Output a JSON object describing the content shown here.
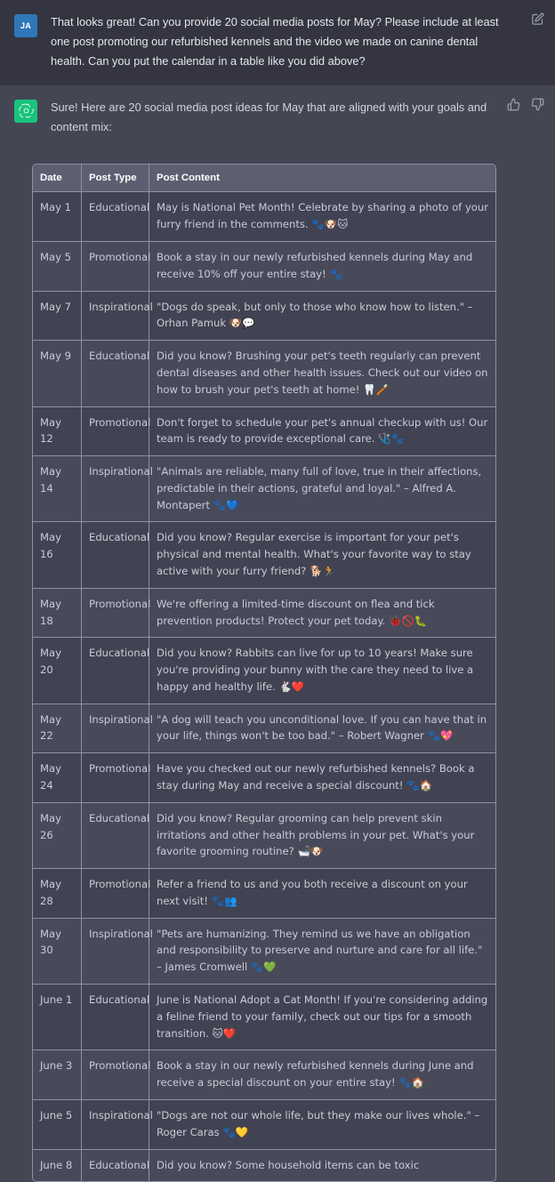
{
  "conversation": {
    "user_message": {
      "avatar_initials": "JA",
      "avatar_color": "#2f77b8",
      "text": "That looks great! Can you provide 20 social media posts for May? Please include at least one post promoting our refurbished kennels and the video we made on canine dental health. Can you put the calendar in a table like you did above?",
      "edit_icon": "edit-pencil-square-icon"
    },
    "assistant_message": {
      "avatar_color": "#19c37d",
      "avatar_icon": "openai-logo-icon",
      "text": "Sure! Here are 20 social media post ideas for May that are aligned with your goals and content mix:",
      "thumbs_up_icon": "thumbs-up-icon",
      "thumbs_down_icon": "thumbs-down-icon"
    }
  },
  "table": {
    "headers": [
      "Date",
      "Post Type",
      "Post Content"
    ],
    "rows": [
      {
        "date": "May 1",
        "type": "Educational",
        "content": "May is National Pet Month! Celebrate by sharing a photo of your furry friend in the comments. 🐾🐶🐱"
      },
      {
        "date": "May 5",
        "type": "Promotional",
        "content": "Book a stay in our newly refurbished kennels during May and receive 10% off your entire stay! 🐾"
      },
      {
        "date": "May 7",
        "type": "Inspirational",
        "content": "\"Dogs do speak, but only to those who know how to listen.\" – Orhan Pamuk 🐶💬"
      },
      {
        "date": "May 9",
        "type": "Educational",
        "content": "Did you know? Brushing your pet's teeth regularly can prevent dental diseases and other health issues. Check out our video on how to brush your pet's teeth at home! 🦷🪥"
      },
      {
        "date": "May 12",
        "type": "Promotional",
        "content": "Don't forget to schedule your pet's annual checkup with us! Our team is ready to provide exceptional care. 🩺🐾"
      },
      {
        "date": "May 14",
        "type": "Inspirational",
        "content": "\"Animals are reliable, many full of love, true in their affections, predictable in their actions, grateful and loyal.\" – Alfred A. Montapert 🐾💙"
      },
      {
        "date": "May 16",
        "type": "Educational",
        "content": "Did you know? Regular exercise is important for your pet's physical and mental health. What's your favorite way to stay active with your furry friend? 🐕🏃"
      },
      {
        "date": "May 18",
        "type": "Promotional",
        "content": "We're offering a limited-time discount on flea and tick prevention products! Protect your pet today. 🐞🚫🐛"
      },
      {
        "date": "May 20",
        "type": "Educational",
        "content": "Did you know? Rabbits can live for up to 10 years! Make sure you're providing your bunny with the care they need to live a happy and healthy life. 🐇❤️"
      },
      {
        "date": "May 22",
        "type": "Inspirational",
        "content": "\"A dog will teach you unconditional love. If you can have that in your life, things won't be too bad.\" – Robert Wagner 🐾💖"
      },
      {
        "date": "May 24",
        "type": "Promotional",
        "content": "Have you checked out our newly refurbished kennels? Book a stay during May and receive a special discount! 🐾🏠"
      },
      {
        "date": "May 26",
        "type": "Educational",
        "content": "Did you know? Regular grooming can help prevent skin irritations and other health problems in your pet. What's your favorite grooming routine? 🛁🐶"
      },
      {
        "date": "May 28",
        "type": "Promotional",
        "content": "Refer a friend to us and you both receive a discount on your next visit! 🐾👥"
      },
      {
        "date": "May 30",
        "type": "Inspirational",
        "content": "\"Pets are humanizing. They remind us we have an obligation and responsibility to preserve and nurture and care for all life.\" – James Cromwell 🐾💚"
      },
      {
        "date": "June 1",
        "type": "Educational",
        "content": "June is National Adopt a Cat Month! If you're considering adding a feline friend to your family, check out our tips for a smooth transition. 🐱❤️"
      },
      {
        "date": "June 3",
        "type": "Promotional",
        "content": "Book a stay in our newly refurbished kennels during June and receive a special discount on your entire stay! 🐾🏠"
      },
      {
        "date": "June 5",
        "type": "Inspirational",
        "content": "\"Dogs are not our whole life, but they make our lives whole.\" – Roger Caras 🐾💛"
      },
      {
        "date": "June 8",
        "type": "Educational",
        "content": "Did you know? Some household items can be toxic"
      }
    ]
  }
}
